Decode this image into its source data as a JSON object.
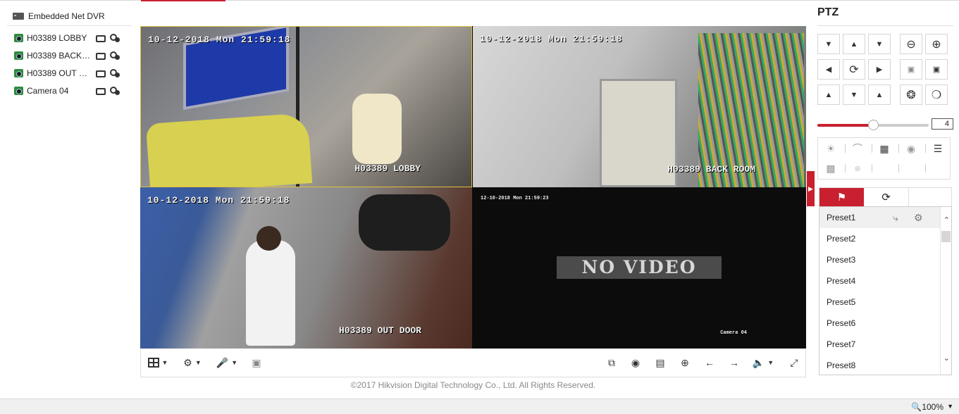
{
  "device": {
    "name": "Embedded Net DVR"
  },
  "cameras": [
    {
      "label": "H03389 LOBBY"
    },
    {
      "label": "H03389 BACK ROOM"
    },
    {
      "label": "H03389 OUT DOOR"
    },
    {
      "label": "Camera 04"
    }
  ],
  "tiles": [
    {
      "timestamp": "10-12-2018 Mon 21:59:18",
      "name": "H03389 LOBBY"
    },
    {
      "timestamp": "10-12-2018 Mon 21:59:18",
      "name": "H03389 BACK ROOM"
    },
    {
      "timestamp": "10-12-2018 Mon 21:59:18",
      "name": "H03389 OUT DOOR"
    },
    {
      "timestamp": "12-10-2018 Mon 21:59:23",
      "name": "Camera 04",
      "message": "NO VIDEO"
    }
  ],
  "footer": {
    "copyright": "©2017 Hikvision Digital Technology Co., Ltd. All Rights Reserved."
  },
  "ptz": {
    "title": "PTZ",
    "speed": "4",
    "speed_level_fraction": 0.5,
    "presets": [
      "Preset1",
      "Preset2",
      "Preset3",
      "Preset4",
      "Preset5",
      "Preset6",
      "Preset7",
      "Preset8"
    ]
  },
  "status": {
    "zoom": "100%"
  },
  "colors": {
    "accent": "#c8202f",
    "selected_tile_border": "#e0c040"
  }
}
